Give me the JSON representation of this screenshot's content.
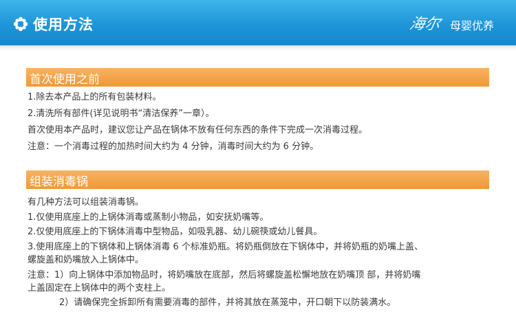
{
  "header": {
    "title": "使用方法",
    "brand_logo": "海尔",
    "brand_tagline": "母婴优养"
  },
  "sections": [
    {
      "title": "首次使用之前",
      "lines": [
        "1.除去本产品上的所有包装材料。",
        "2.清洗所有部件(详见说明书“清洁保养”一章）。",
        "首次使用本产品时，建议您让产品在锅体不放有任何东西的条件下完成一次消毒过程。",
        "注意：一个消毒过程的加热时间大约为 4 分钟，消毒时间大约为 6 分钟。"
      ]
    },
    {
      "title": "组装消毒锅",
      "lines": [
        "有几种方法可以组装消毒锅。",
        "1.仅使用底座上的上锅体消毒或蒸制小物品，如安抚奶嘴等。",
        "2.仅使用底座上的下锅体消毒中型物品，如吸乳器、幼儿碗筷或幼儿餐具。",
        "3.使用底座上的下锅体和上锅体消毒 6 个标准奶瓶。将奶瓶倒放在下锅体中，并将奶瓶的奶嘴上盖、",
        "螺旋盖和奶嘴放入上锅体中。",
        "注意：1）向上锅体中添加物品时，将奶嘴放在底部，然后将螺旋盖松懈地放在奶嘴顶  部，并将奶嘴",
        "上盖固定在上锅体中的两个支柱上。",
        "2）请确保完全拆卸所有需要消毒的部件，并将其放在蒸笼中，开口朝下以防装满水。"
      ]
    }
  ],
  "colors": {
    "header_blue": "#1e95d8",
    "section_orange": "#f4a44c",
    "text": "#3a3a3a"
  }
}
